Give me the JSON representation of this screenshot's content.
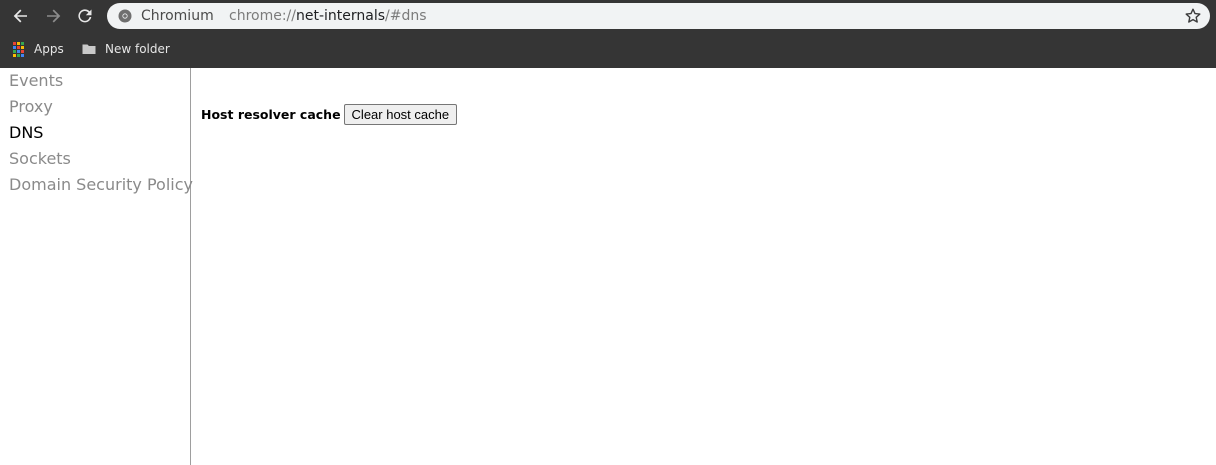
{
  "browser": {
    "site_name": "Chromium",
    "url_scheme": "chrome://",
    "url_host": "net-internals",
    "url_rest": "/#dns",
    "icons": {
      "back": "arrow-left-icon",
      "forward": "arrow-right-icon",
      "reload": "reload-icon",
      "site": "chromium-site-icon",
      "bookmark_star": "star-icon"
    }
  },
  "bookmarks": [
    {
      "label": "Apps",
      "icon": "apps-grid-icon"
    },
    {
      "label": "New folder",
      "icon": "folder-icon"
    }
  ],
  "sidebar": {
    "items": [
      {
        "label": "Events",
        "selected": false
      },
      {
        "label": "Proxy",
        "selected": false
      },
      {
        "label": "DNS",
        "selected": true
      },
      {
        "label": "Sockets",
        "selected": false
      },
      {
        "label": "Domain Security Policy",
        "selected": false
      }
    ]
  },
  "dns": {
    "cache_label": "Host resolver cache",
    "clear_button": "Clear host cache"
  },
  "colors": {
    "chrome_bg": "#353535",
    "omnibox_bg": "#f1f3f4",
    "tab_inactive": "#8a8a8a",
    "tab_active": "#000000"
  }
}
